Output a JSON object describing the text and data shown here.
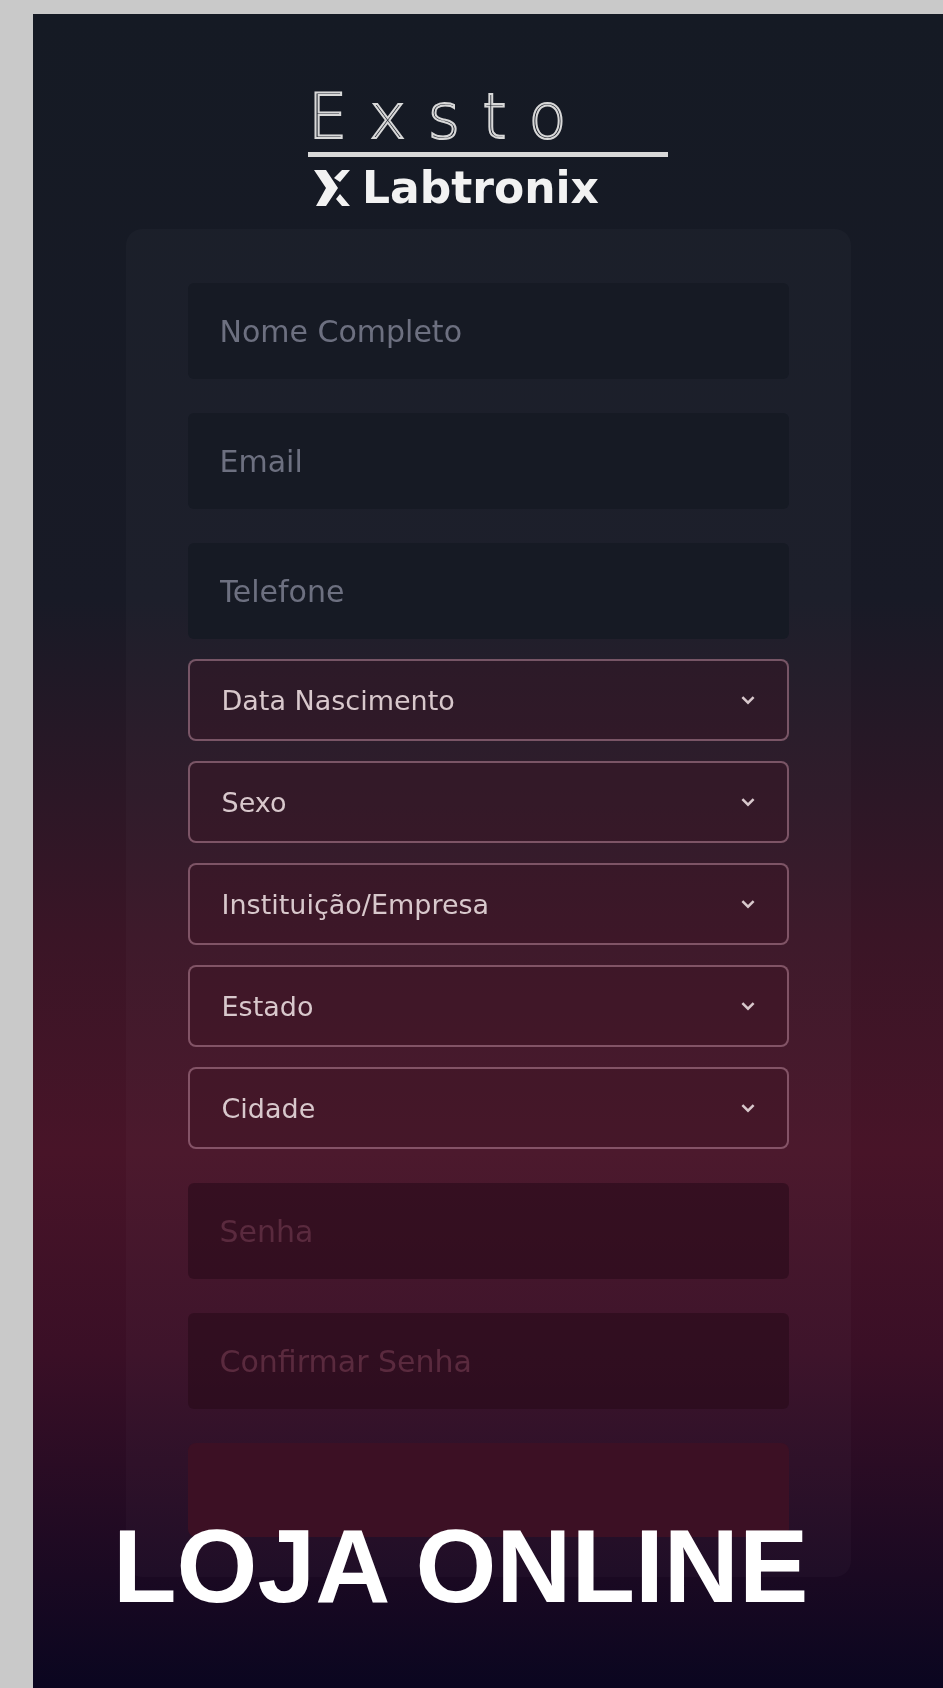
{
  "logo": {
    "brand": "Exsto",
    "partner": "Labtronix"
  },
  "fields": [
    {
      "kind": "text",
      "placeholder": "Nome Completo"
    },
    {
      "kind": "text",
      "placeholder": "Email"
    },
    {
      "kind": "text",
      "placeholder": "Telefone"
    },
    {
      "kind": "select",
      "label": "Data Nascimento"
    },
    {
      "kind": "select",
      "label": "Sexo"
    },
    {
      "kind": "select",
      "label": "Instituição/Empresa"
    },
    {
      "kind": "select",
      "label": "Estado"
    },
    {
      "kind": "select",
      "label": "Cidade"
    },
    {
      "kind": "password",
      "placeholder": "Senha"
    },
    {
      "kind": "password",
      "placeholder": "Confirmar Senha"
    }
  ],
  "overlay_title": "LOJA ONLINE"
}
